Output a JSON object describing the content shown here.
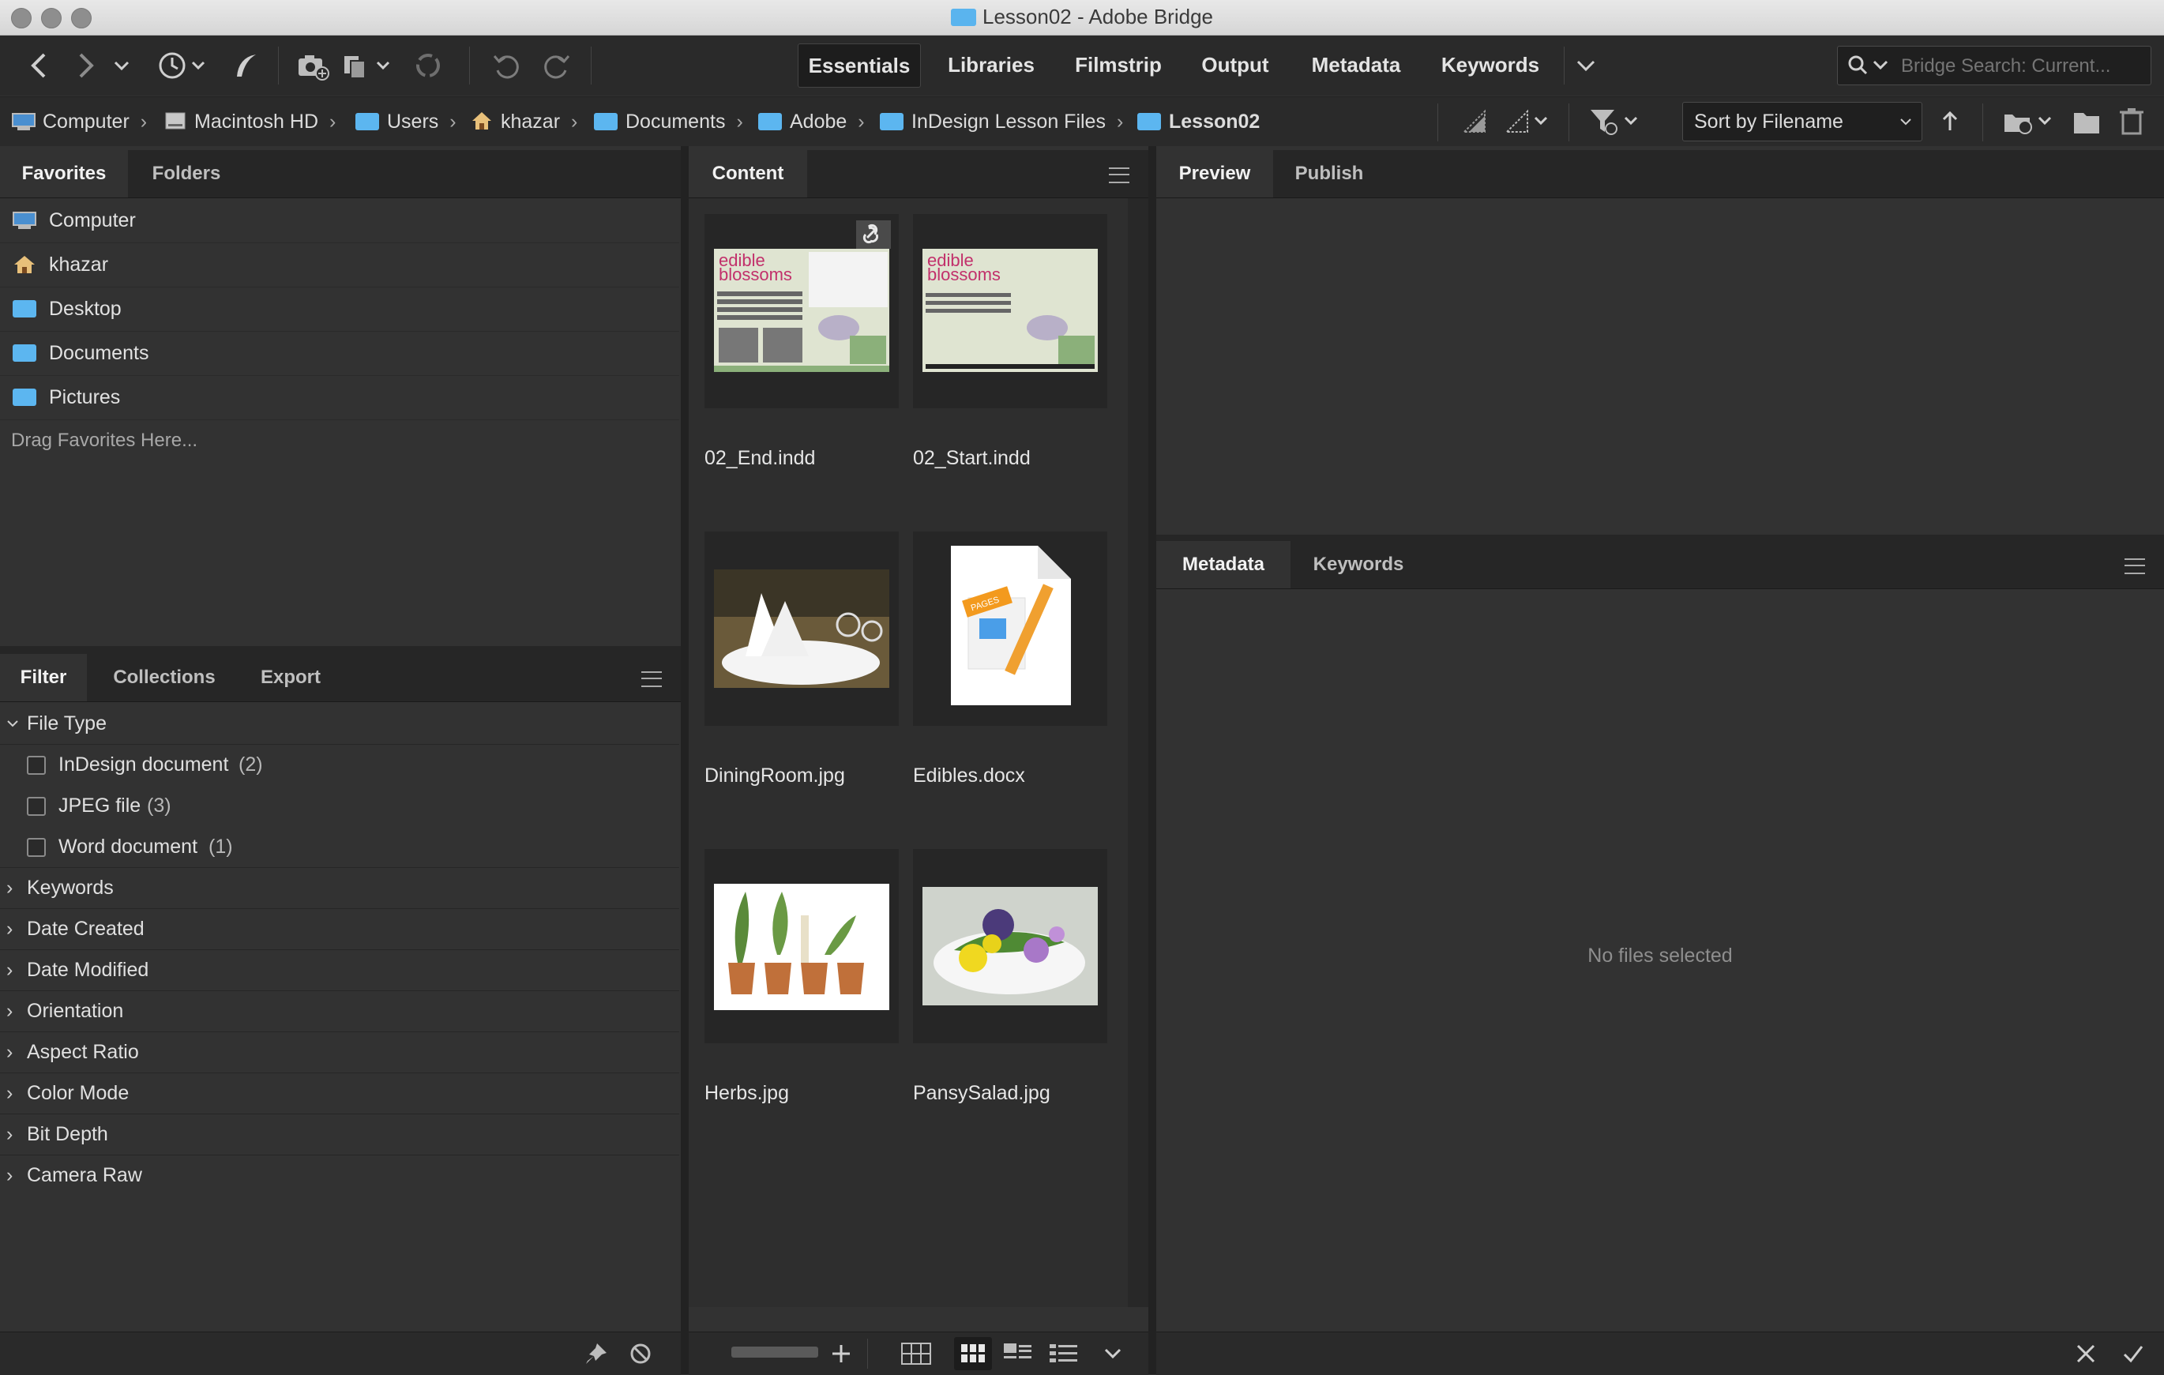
{
  "window": {
    "title": "Lesson02 - Adobe Bridge"
  },
  "workspaces": [
    "Essentials",
    "Libraries",
    "Filmstrip",
    "Output",
    "Metadata",
    "Keywords"
  ],
  "search": {
    "placeholder": "Bridge Search: Current..."
  },
  "breadcrumb": [
    "Computer",
    "Macintosh HD",
    "Users",
    "khazar",
    "Documents",
    "Adobe",
    "InDesign Lesson Files",
    "Lesson02"
  ],
  "sort": {
    "label": "Sort by Filename"
  },
  "left_tabs": [
    "Favorites",
    "Folders"
  ],
  "favorites": {
    "items": [
      "Computer",
      "khazar",
      "Desktop",
      "Documents",
      "Pictures"
    ],
    "hint": "Drag Favorites Here..."
  },
  "filter_tabs": [
    "Filter",
    "Collections",
    "Export"
  ],
  "filter": {
    "file_type_label": "File Type",
    "file_types": [
      {
        "name": "InDesign document",
        "count": "(2)"
      },
      {
        "name": "JPEG file",
        "count": "(3)"
      },
      {
        "name": "Word document",
        "count": "(1)"
      }
    ],
    "groups": [
      "Keywords",
      "Date Created",
      "Date Modified",
      "Orientation",
      "Aspect Ratio",
      "Color Mode",
      "Bit Depth",
      "Camera Raw"
    ]
  },
  "content": {
    "tab": "Content",
    "files": [
      "02_End.indd",
      "02_Start.indd",
      "DiningRoom.jpg",
      "Edibles.docx",
      "Herbs.jpg",
      "PansySalad.jpg"
    ],
    "thumb_text": {
      "edible": "edible",
      "blossoms": "blossoms",
      "pages": "PAGES"
    }
  },
  "preview_tabs": [
    "Preview",
    "Publish"
  ],
  "metadata_tabs": [
    "Metadata",
    "Keywords"
  ],
  "metadata": {
    "empty": "No files selected"
  },
  "colors": {
    "accent_folder": "#5cb6f0",
    "edible_pink": "#c2306b",
    "thumb_bg": "#dfe4d1"
  }
}
